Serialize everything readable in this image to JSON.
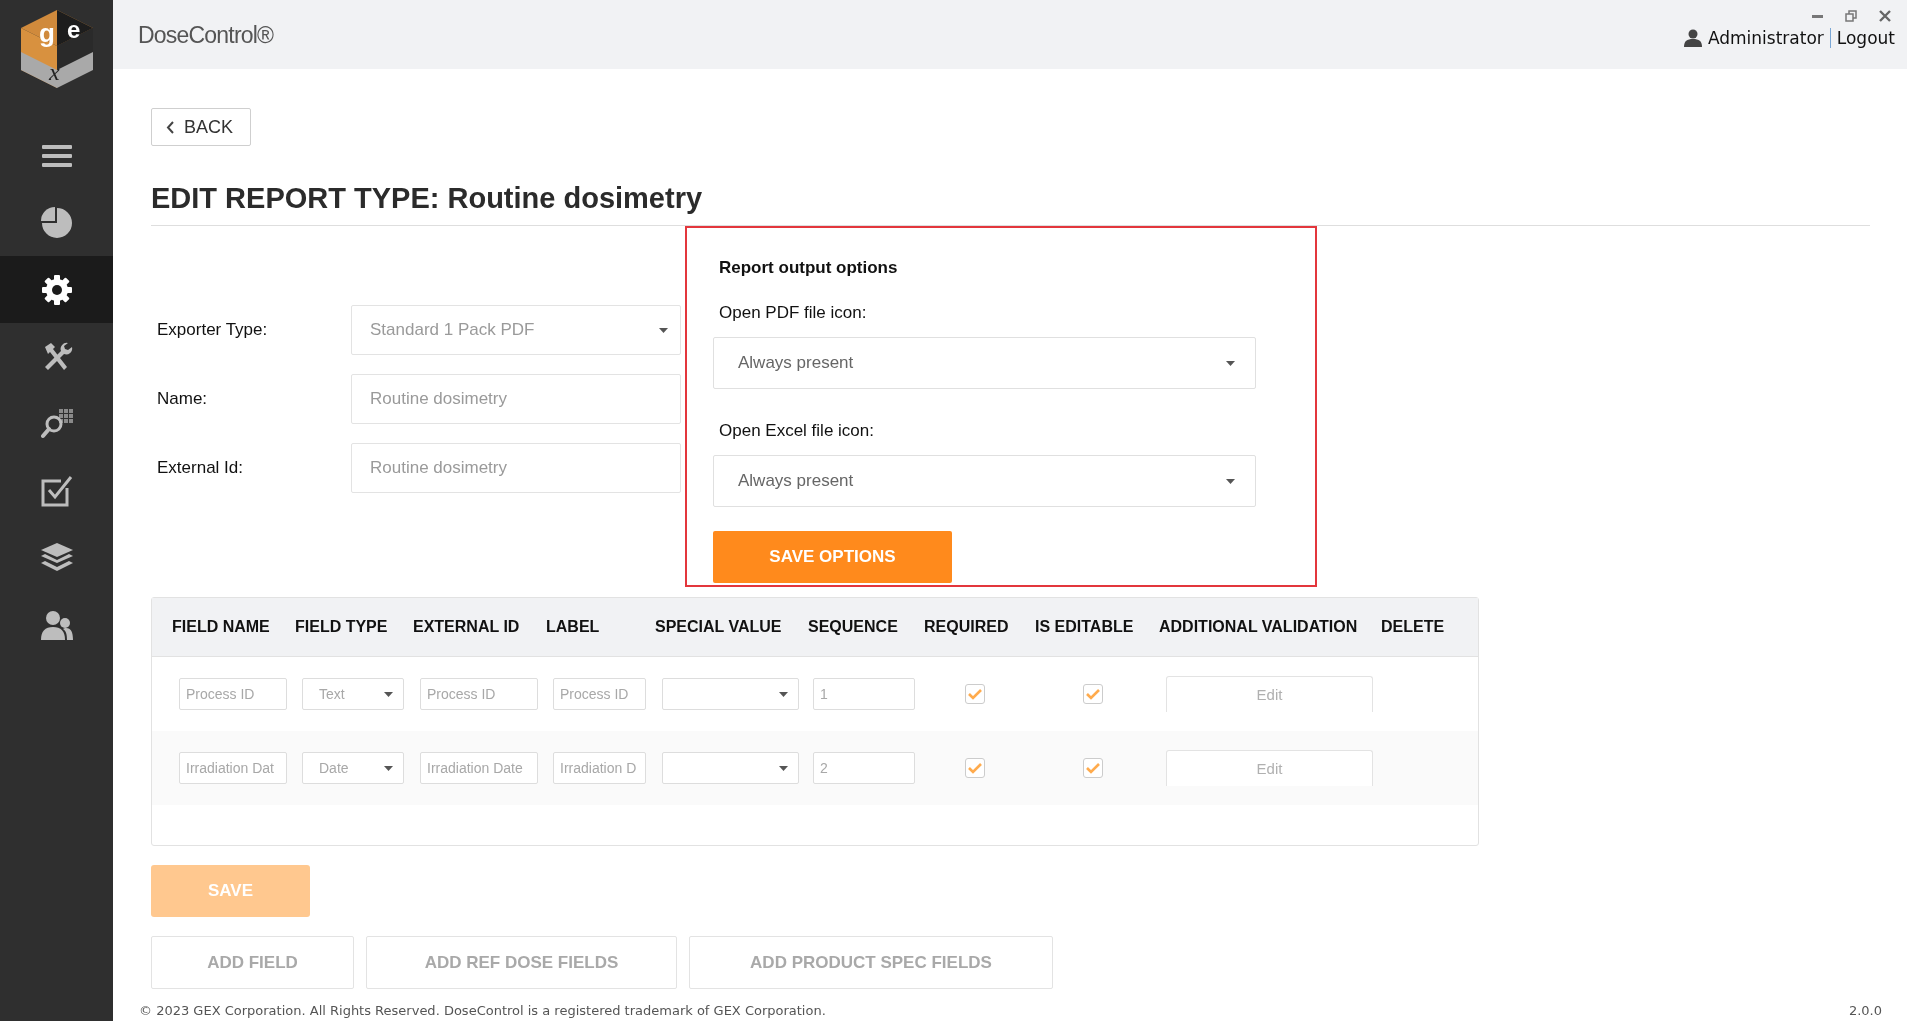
{
  "logo": {
    "letters": [
      "g",
      "e",
      "x"
    ]
  },
  "app": {
    "title": "DoseControl®",
    "footer": "© 2023 GEX Corporation. All Rights Reserved. DoseControl is a registered trademark of GEX Corporation.",
    "version": "2.0.0"
  },
  "user": {
    "name": "Administrator",
    "logout": "Logout"
  },
  "sidebar": {
    "items": [
      {
        "kind": "menu",
        "selected": false
      },
      {
        "kind": "pie",
        "selected": false
      },
      {
        "kind": "gear",
        "selected": true
      },
      {
        "kind": "tools",
        "selected": false
      },
      {
        "kind": "search-grid",
        "selected": false
      },
      {
        "kind": "checkbox",
        "selected": false
      },
      {
        "kind": "layers",
        "selected": false
      },
      {
        "kind": "users",
        "selected": false
      }
    ]
  },
  "back_button": "BACK",
  "title": "EDIT REPORT TYPE: Routine dosimetry",
  "form": [
    {
      "label": "Exporter Type:",
      "value": "Standard 1 Pack PDF",
      "kind": "select"
    },
    {
      "label": "Name:",
      "placeholder": "Routine dosimetry",
      "kind": "text"
    },
    {
      "label": "External Id:",
      "placeholder": "Routine dosimetry",
      "kind": "text"
    }
  ],
  "options_panel": {
    "title": "Report output options",
    "fields": [
      {
        "label": "Open PDF file icon:",
        "value": "Always present"
      },
      {
        "label": "Open Excel file icon:",
        "value": "Always present"
      }
    ],
    "save_button": "SAVE OPTIONS"
  },
  "table": {
    "columns": [
      "FIELD NAME",
      "FIELD TYPE",
      "EXTERNAL ID",
      "LABEL",
      "SPECIAL VALUE",
      "SEQUENCE",
      "REQUIRED",
      "IS EDITABLE",
      "ADDITIONAL VALIDATION",
      "DELETE"
    ],
    "rows": [
      {
        "field_name": "Process ID",
        "field_type": "Text",
        "external_id": "Process ID",
        "label": "Process ID",
        "sequence": "1",
        "required": true,
        "is_editable": true,
        "validation": "Edit"
      },
      {
        "field_name": "Irradiation Dat",
        "field_type": "Date",
        "external_id": "Irradiation Date",
        "label": "Irradiation D",
        "sequence": "2",
        "required": true,
        "is_editable": true,
        "validation": "Edit"
      }
    ]
  },
  "save_button": {
    "label": "SAVE",
    "disabled": true
  },
  "add_buttons": [
    "ADD FIELD",
    "ADD REF DOSE FIELDS",
    "ADD PRODUCT SPEC FIELDS"
  ]
}
